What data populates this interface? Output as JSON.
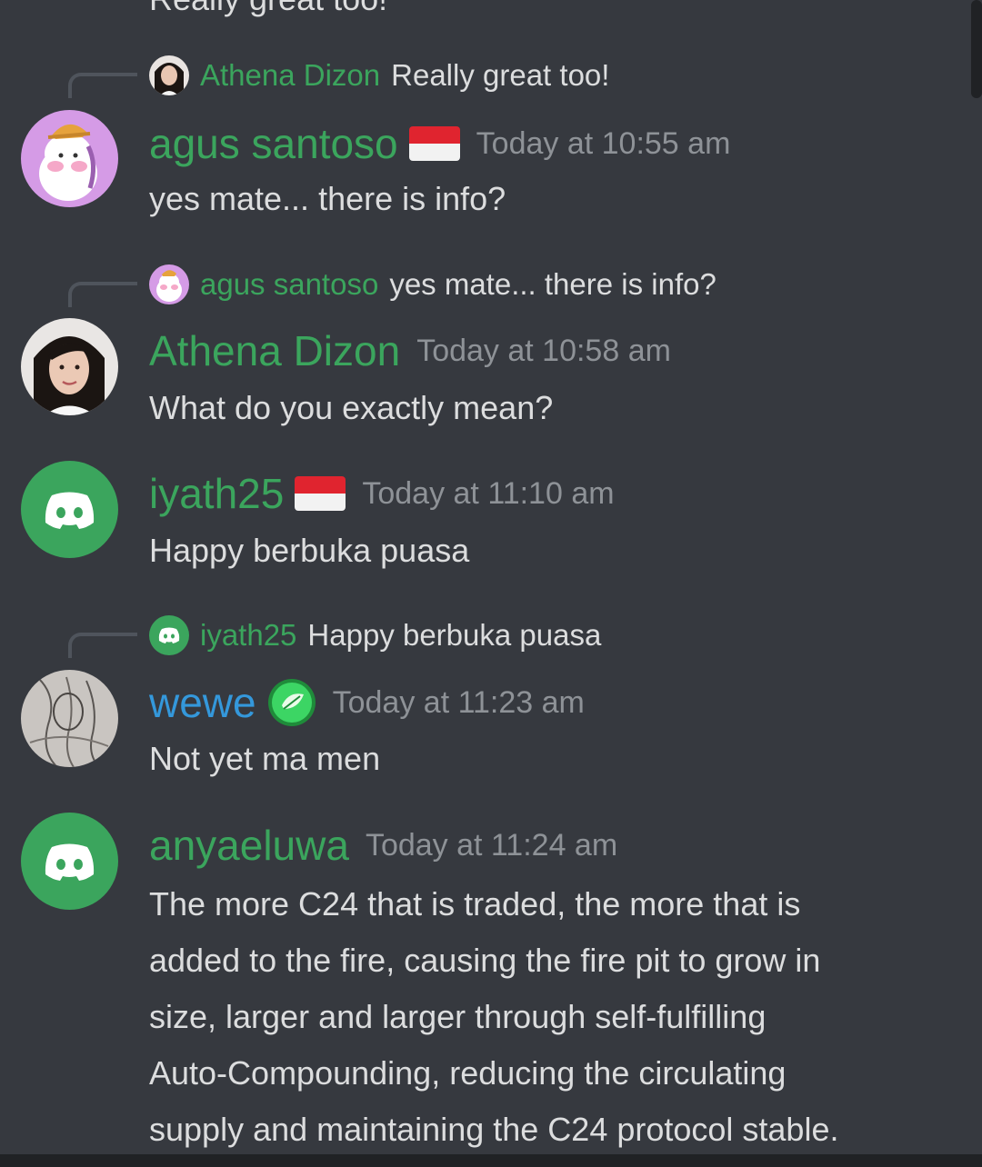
{
  "top_cutoff_text": "Really great too!",
  "colors": {
    "background": "#36393f",
    "username_green": "#3ba55d",
    "username_blue": "#3498db",
    "timestamp": "#8e9297",
    "text": "#dcddde"
  },
  "messages": [
    {
      "reply": {
        "author": "Athena Dizon",
        "text": "Really great too!"
      },
      "author": "agus santoso",
      "flag": "indonesia-flag",
      "time": "Today at 10:55 am",
      "text": "yes mate... there is info?"
    },
    {
      "reply": {
        "author": "agus santoso",
        "text": "yes mate... there is info?"
      },
      "author": "Athena Dizon",
      "time": "Today at 10:58 am",
      "text": "What do you exactly mean?"
    },
    {
      "author": "iyath25",
      "flag": "indonesia-flag",
      "time": "Today at 11:10 am",
      "text": "Happy berbuka puasa"
    },
    {
      "reply": {
        "author": "iyath25",
        "text": "Happy berbuka puasa"
      },
      "author": "wewe",
      "badge": "leaf-badge-icon",
      "time": "Today at 11:23 am",
      "text": "Not yet ma men"
    },
    {
      "author": "anyaeluwa",
      "time": "Today at 11:24 am",
      "text_lines": [
        "The more C24 that is traded, the more that is",
        "added to the fire, causing the fire pit to grow in",
        "size, larger and larger through self-fulfilling",
        "Auto-Compounding, reducing the circulating",
        "supply and maintaining the C24 protocol stable."
      ]
    }
  ]
}
